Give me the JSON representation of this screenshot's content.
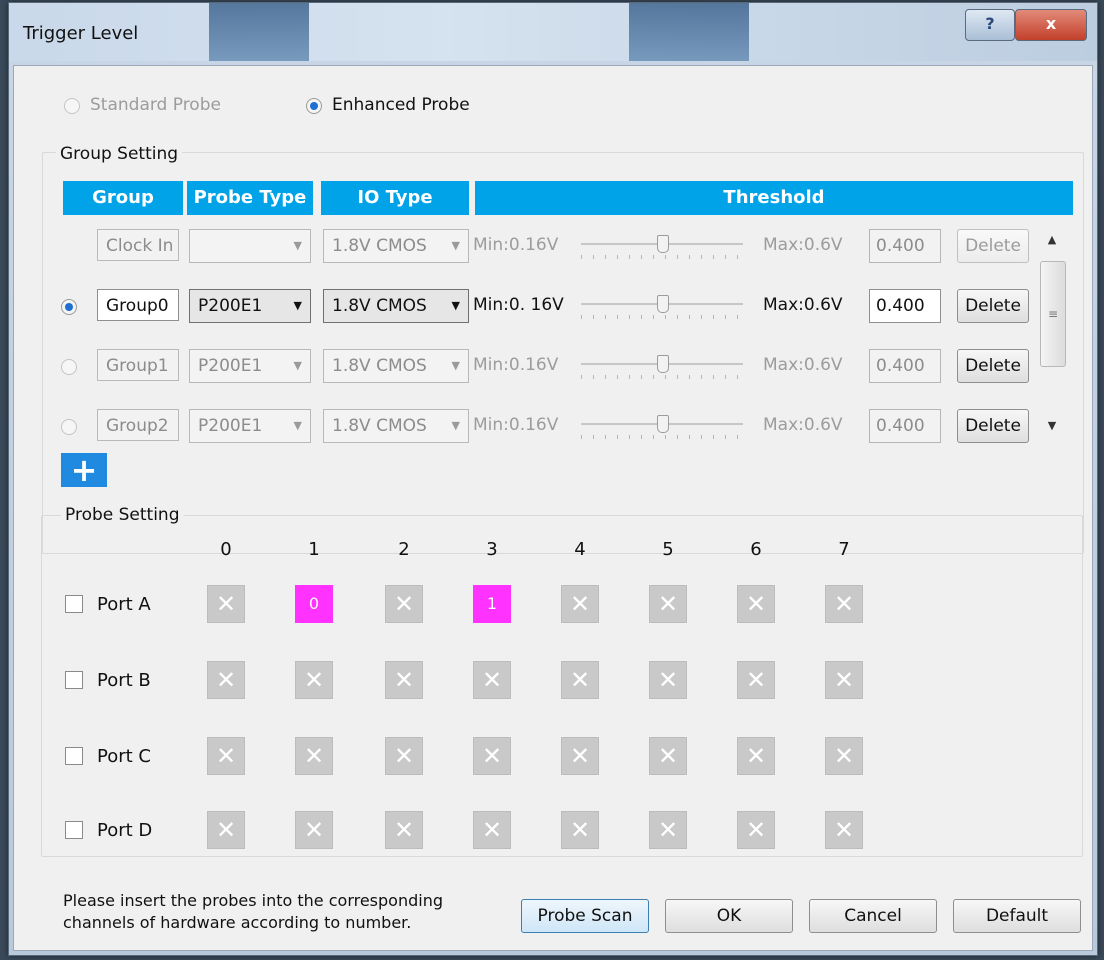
{
  "window": {
    "title": "Trigger Level",
    "help_glyph": "?",
    "close_glyph": "x"
  },
  "mode": {
    "standard_label": "Standard Probe",
    "enhanced_label": "Enhanced Probe",
    "selected": "Enhanced Probe"
  },
  "group_setting": {
    "label": "Group Setting",
    "headers": {
      "group": "Group",
      "probe_type": "Probe Type",
      "io_type": "IO Type",
      "threshold": "Threshold"
    },
    "rows": [
      {
        "name": "Clock In",
        "probe_type": "",
        "io_type": "1.8V CMOS",
        "min": "Min:0.16V",
        "max": "Max:0.6V",
        "value": "0.400",
        "delete": "Delete",
        "level": 0.5,
        "selected": false,
        "active": false,
        "has_radio": false
      },
      {
        "name": "Group0",
        "probe_type": "P200E1",
        "io_type": "1.8V CMOS",
        "min": "Min:0. 16V",
        "max": "Max:0.6V",
        "value": "0.400",
        "delete": "Delete",
        "level": 0.5,
        "selected": true,
        "active": true,
        "has_radio": true
      },
      {
        "name": "Group1",
        "probe_type": "P200E1",
        "io_type": "1.8V CMOS",
        "min": "Min:0.16V",
        "max": "Max:0.6V",
        "value": "0.400",
        "delete": "Delete",
        "level": 0.5,
        "selected": false,
        "active": false,
        "has_radio": true
      },
      {
        "name": "Group2",
        "probe_type": "P200E1",
        "io_type": "1.8V CMOS",
        "min": "Min:0.16V",
        "max": "Max:0.6V",
        "value": "0.400",
        "delete": "Delete",
        "level": 0.5,
        "selected": false,
        "active": false,
        "has_radio": true
      }
    ],
    "add_glyph": "+"
  },
  "probe_setting": {
    "label": "Probe Setting",
    "columns": [
      "0",
      "1",
      "2",
      "3",
      "4",
      "5",
      "6",
      "7"
    ],
    "ports": [
      {
        "name": "Port A",
        "channels": [
          "x",
          "0",
          "x",
          "1",
          "x",
          "x",
          "x",
          "x"
        ]
      },
      {
        "name": "Port B",
        "channels": [
          "x",
          "x",
          "x",
          "x",
          "x",
          "x",
          "x",
          "x"
        ]
      },
      {
        "name": "Port C",
        "channels": [
          "x",
          "x",
          "x",
          "x",
          "x",
          "x",
          "x",
          "x"
        ]
      },
      {
        "name": "Port D",
        "channels": [
          "x",
          "x",
          "x",
          "x",
          "x",
          "x",
          "x",
          "x"
        ]
      }
    ]
  },
  "footer": {
    "instruction_line1": "Please insert the probes into the corresponding",
    "instruction_line2": "channels of hardware according to number.",
    "probe_scan": "Probe Scan",
    "ok": "OK",
    "cancel": "Cancel",
    "default": "Default"
  },
  "colors": {
    "header_blue": "#00a2e8",
    "assigned_channel": "#ff32ff",
    "empty_channel": "#c9c9c9"
  }
}
